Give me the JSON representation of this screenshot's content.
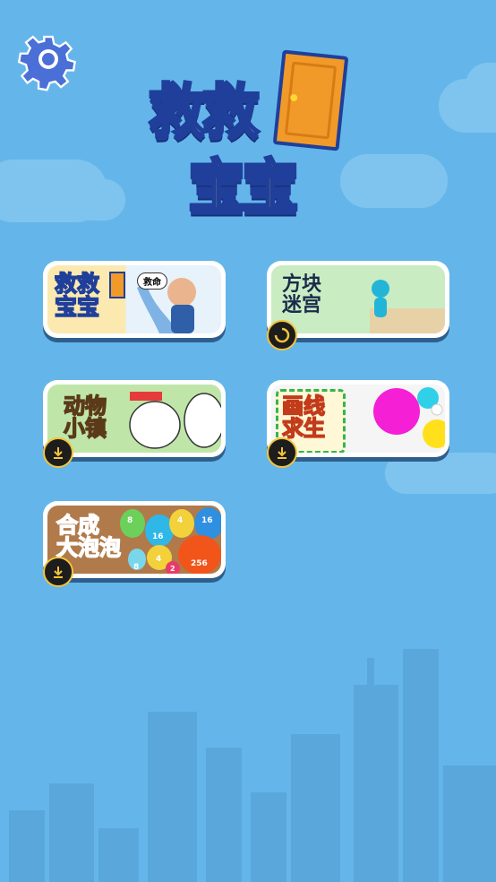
{
  "app": {
    "title_line1": "救救",
    "title_line2": "宝宝"
  },
  "settings": {
    "icon": "gear-icon"
  },
  "games": [
    {
      "id": "jiujiu-baobao",
      "title": "救救\n宝宝",
      "tag": "救命",
      "status": "installed"
    },
    {
      "id": "fangkuai-migong",
      "title": "方块\n迷宫",
      "status": "loading"
    },
    {
      "id": "dongwu-xiaozhen",
      "title": "动物\n小镇",
      "status": "download"
    },
    {
      "id": "huaxian-qiusheng",
      "title": "画线\n求生",
      "status": "download"
    },
    {
      "id": "hecheng-dapaopao",
      "title": "合成\n大泡泡",
      "status": "download",
      "bubbles": [
        "8",
        "4",
        "16",
        "16",
        "4",
        "256",
        "8",
        "2"
      ]
    }
  ],
  "colors": {
    "sky": "#64b6ea",
    "cloud": "#7fc4ee",
    "city": "#5aa7dc",
    "gear": "#4a6fd6",
    "badge_ring": "#f3c43a"
  }
}
